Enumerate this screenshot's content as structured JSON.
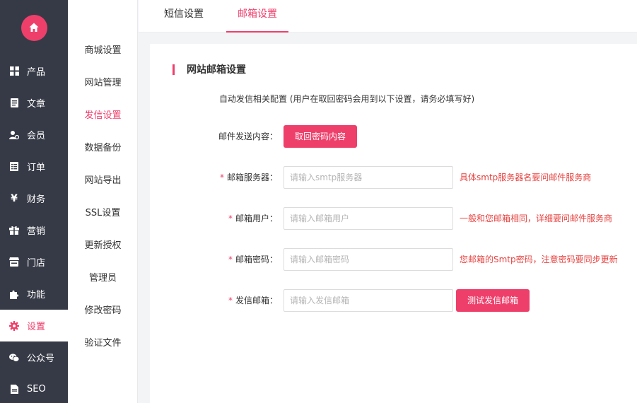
{
  "sidebar": {
    "logo_icon": "home-icon",
    "items": [
      {
        "label": "产品",
        "icon": "grid-icon"
      },
      {
        "label": "文章",
        "icon": "document-icon"
      },
      {
        "label": "会员",
        "icon": "user-icon"
      },
      {
        "label": "订单",
        "icon": "list-icon"
      },
      {
        "label": "财务",
        "icon": "yen-icon"
      },
      {
        "label": "营销",
        "icon": "gift-icon"
      },
      {
        "label": "门店",
        "icon": "store-icon"
      },
      {
        "label": "功能",
        "icon": "puzzle-icon"
      },
      {
        "label": "设置",
        "icon": "gear-icon"
      },
      {
        "label": "公众号",
        "icon": "wechat-icon"
      },
      {
        "label": "SEO",
        "icon": "seo-icon"
      }
    ],
    "active_index": 8
  },
  "submenu": {
    "items": [
      "商城设置",
      "网站管理",
      "发信设置",
      "数据备份",
      "网站导出",
      "SSL设置",
      "更新授权",
      "管理员",
      "修改密码",
      "验证文件"
    ],
    "active_index": 2
  },
  "tabs": {
    "items": [
      "短信设置",
      "邮箱设置"
    ],
    "active_index": 1
  },
  "content": {
    "section_title": "网站邮箱设置",
    "description": "自动发信相关配置 (用户在取回密码会用到以下设置，请务必填写好)",
    "mail_content_label": "邮件发送内容：",
    "mail_content_button": "取回密码内容",
    "fields": [
      {
        "label": "邮箱服务器：",
        "placeholder": "请输入smtp服务器",
        "hint": "具体smtp服务器名要问邮件服务商"
      },
      {
        "label": "邮箱用户：",
        "placeholder": "请输入邮箱用户",
        "hint": "一般和您邮箱相同，详细要问邮件服务商"
      },
      {
        "label": "邮箱密码：",
        "placeholder": "请输入邮箱密码",
        "hint": "您邮箱的Smtp密码，注意密码要同步更新"
      },
      {
        "label": "发信邮箱：",
        "placeholder": "请输入发信邮箱",
        "hint": ""
      }
    ],
    "required_mark": "*",
    "test_button": "测试发信邮箱"
  },
  "colors": {
    "accent": "#ee3f6b",
    "sidebar_bg": "#363a46",
    "hint": "#e64340"
  }
}
